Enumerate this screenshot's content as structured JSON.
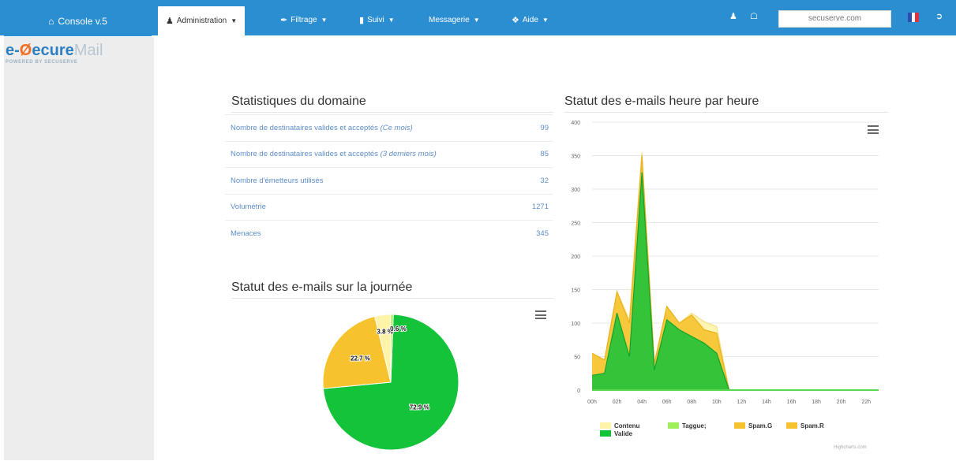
{
  "nav": {
    "brand": "Console v.5",
    "menus": [
      {
        "label": "Administration",
        "icon": "user-icon"
      },
      {
        "label": "Filtrage",
        "icon": "wrench-icon"
      },
      {
        "label": "Suivi",
        "icon": "bar-chart-icon"
      },
      {
        "label": "Messagerie",
        "icon": ""
      },
      {
        "label": "Aide",
        "icon": "info-circle-icon"
      }
    ],
    "domain": "secuserve.com"
  },
  "logo": {
    "text_e": "e-",
    "text_secure": "ecure",
    "text_mail": "Mail",
    "powered": "POWERED BY SECUSERVE",
    "colors": {
      "orange": "#ef6e22",
      "blue": "#2d7fc1",
      "grey": "#b9c6d2"
    }
  },
  "stats": {
    "title": "Statistiques du domaine",
    "rows": [
      {
        "label": "Nombre de destinataires valides et acceptés",
        "note": "(Ce mois)",
        "value": "99"
      },
      {
        "label": "Nombre de destinataires valides et acceptés",
        "note": "(3 derniers mois)",
        "value": "85"
      },
      {
        "label": "Nombre d'émetteurs utilisés",
        "note": "",
        "value": "32"
      },
      {
        "label": "Volumétrie",
        "note": "",
        "value": "1271"
      },
      {
        "label": "Menaces",
        "note": "",
        "value": "345"
      }
    ]
  },
  "pie": {
    "title": "Statut des e-mails sur la journée"
  },
  "area": {
    "title": "Statut des e-mails heure par heure",
    "credits": "Highcharts.com"
  },
  "chart_data": [
    {
      "type": "pie",
      "title": "Statut des e-mails sur la journée",
      "slices": [
        {
          "label": "72.9 %",
          "value": 72.9,
          "color": "#13c33a"
        },
        {
          "label": "22.7 %",
          "value": 22.7,
          "color": "#f6c32f"
        },
        {
          "label": "3.8 %",
          "value": 3.8,
          "color": "#fff3a8"
        },
        {
          "label": "0.6 %",
          "value": 0.6,
          "color": "#9ef05a"
        }
      ]
    },
    {
      "type": "area",
      "title": "Statut des e-mails heure par heure",
      "x": [
        "00h",
        "01h",
        "02h",
        "03h",
        "04h",
        "05h",
        "06h",
        "07h",
        "08h",
        "09h",
        "10h",
        "11h",
        "12h",
        "13h",
        "14h",
        "15h",
        "16h",
        "17h",
        "18h",
        "19h",
        "20h",
        "21h",
        "22h",
        "23h"
      ],
      "x_tick_labels": [
        "00h",
        "02h",
        "04h",
        "06h",
        "08h",
        "10h",
        "12h",
        "14h",
        "16h",
        "18h",
        "20h",
        "22h"
      ],
      "ylim": [
        0,
        400
      ],
      "y_ticks": [
        0,
        50,
        100,
        150,
        200,
        250,
        300,
        350,
        400
      ],
      "series": [
        {
          "name": "Contenu",
          "color": "#fff3a8",
          "values": [
            55,
            45,
            147,
            105,
            355,
            40,
            125,
            100,
            115,
            102,
            95,
            0,
            0,
            0,
            0,
            0,
            0,
            0,
            0,
            0,
            0,
            0,
            0,
            0
          ]
        },
        {
          "name": "Taggue;",
          "color": "#9ef05a",
          "values": [
            0,
            0,
            0,
            0,
            0,
            0,
            0,
            0,
            0,
            0,
            0,
            0,
            0,
            0,
            0,
            0,
            0,
            0,
            0,
            0,
            0,
            0,
            0,
            0
          ]
        },
        {
          "name": "Spam.G",
          "color": "#f6c32f",
          "values": [
            0,
            0,
            0,
            0,
            0,
            0,
            0,
            0,
            0,
            0,
            0,
            0,
            0,
            0,
            0,
            0,
            0,
            0,
            0,
            0,
            0,
            0,
            0,
            0
          ]
        },
        {
          "name": "Spam.R",
          "color": "#f6c32f",
          "values": [
            55,
            45,
            147,
            100,
            350,
            40,
            125,
            100,
            112,
            90,
            85,
            0,
            0,
            0,
            0,
            0,
            0,
            0,
            0,
            0,
            0,
            0,
            0,
            0
          ]
        },
        {
          "name": "Valide",
          "color": "#13c33a",
          "values": [
            22,
            25,
            115,
            50,
            325,
            30,
            105,
            90,
            80,
            70,
            55,
            0,
            0,
            0,
            0,
            0,
            0,
            0,
            0,
            0,
            0,
            0,
            0,
            0
          ]
        }
      ],
      "legend_position": "bottom-left"
    }
  ]
}
